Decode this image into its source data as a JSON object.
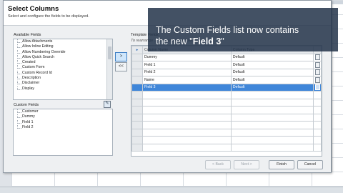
{
  "dialog": {
    "title": "Select Columns",
    "subtitle": "Select and configure the fields to be displayed."
  },
  "available": {
    "label": "Available Fields",
    "items": [
      "Allow Attachments",
      "Allow Inline Editing",
      "Allow Numbering Override",
      "Allow Quick Search",
      "Created",
      "Custom Form",
      "Custom Record Id",
      "Description",
      "Disclaimer",
      "Display"
    ]
  },
  "custom": {
    "label": "Custom Fields",
    "items": [
      "Customer",
      "Dummy",
      "Field 1",
      "Field 2"
    ]
  },
  "mid_buttons": {
    "add": ">",
    "remove": "<<"
  },
  "template": {
    "label": "Template Fields",
    "hint": "To rearrange ... drag and drop column name",
    "header_col1": "Column Name",
    "header_col2": "Column Type",
    "rows": [
      {
        "name": "Dummy",
        "type": "Default"
      },
      {
        "name": "Field 1",
        "type": "Default"
      },
      {
        "name": "Field 2",
        "type": "Default"
      },
      {
        "name": "Name",
        "type": "Default"
      },
      {
        "name": "Field 3",
        "type": "Default"
      }
    ]
  },
  "footer": {
    "back": "< Back",
    "next": "Next >",
    "finish": "Finish",
    "cancel": "Cancel"
  },
  "callout": {
    "line1": "The Custom Fields list now contains",
    "line2_prefix": "the new \"",
    "line2_bold": "Field 3",
    "line2_suffix": "\""
  },
  "colors": {
    "selection": "#3f86d9",
    "callout_bg": "#24344a"
  }
}
